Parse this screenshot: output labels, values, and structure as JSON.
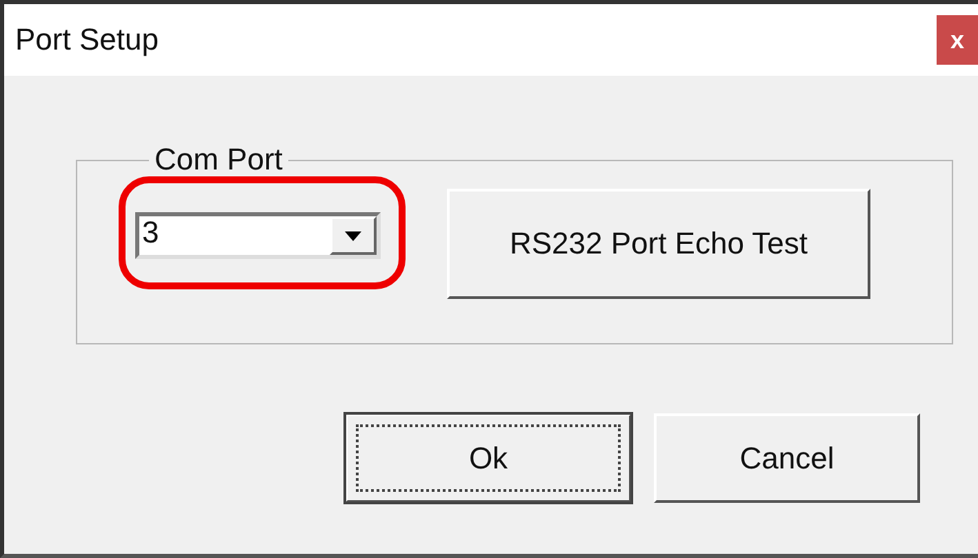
{
  "window": {
    "title": "Port Setup",
    "close": "x"
  },
  "com_port": {
    "label": "Com Port",
    "value": "3",
    "highlighted": true,
    "echo_button": "RS232 Port Echo Test"
  },
  "buttons": [
    {
      "label": "Ok",
      "default": true
    },
    {
      "label": "Cancel",
      "default": false
    }
  ]
}
